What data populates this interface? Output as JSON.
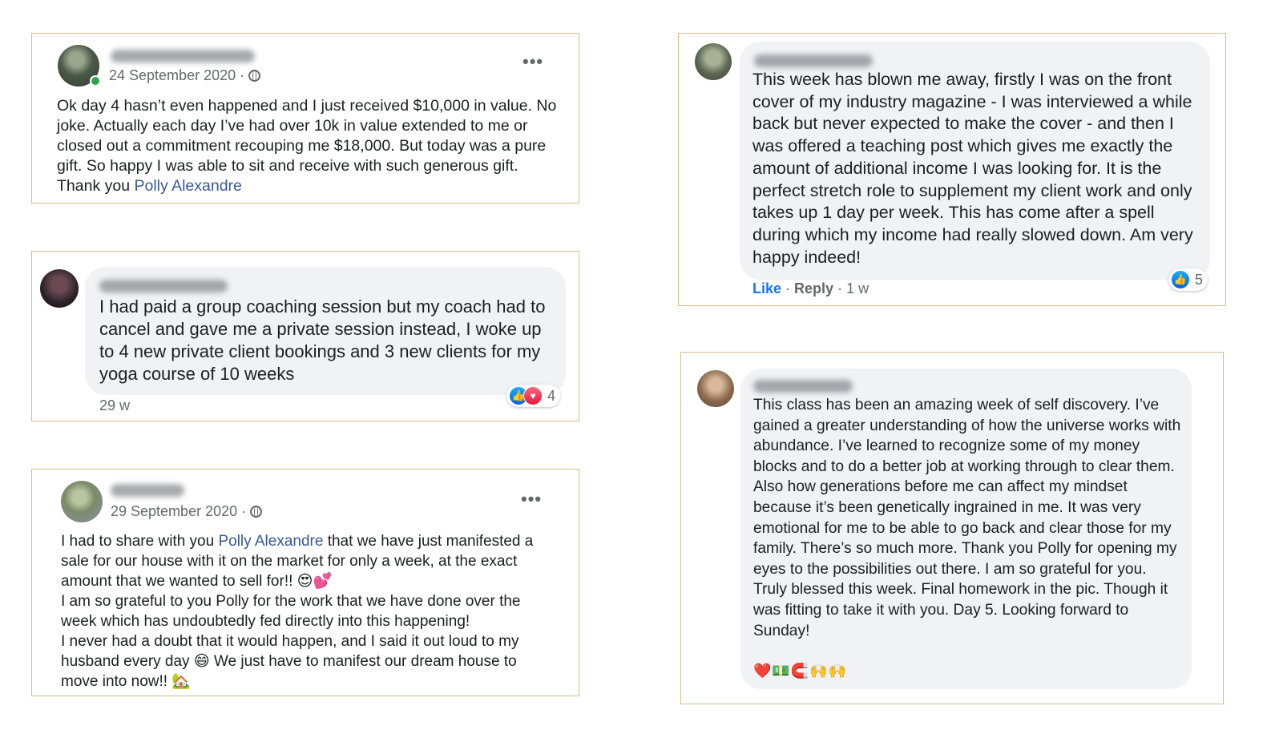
{
  "posts": {
    "p1": {
      "date": "24 September 2020 ·",
      "more_icon": "more-horizontal-icon",
      "text_a": "Ok day 4 hasn’t even happened and I just received $10,000 in value. No joke. Actually each day I’ve had over 10k in value extended to me or closed out a commitment recouping me $18,000. But today was a pure gift. So happy I was able to sit and receive with such generous gift.  Thank you ",
      "mention": "Polly Alexandre"
    },
    "p2": {
      "text": "I had paid a group coaching session but my coach had to cancel and gave me a private session instead, I woke up to 4 new private client bookings and 3 new clients for my yoga course of 10 weeks",
      "time": "29 w",
      "reactions_count": "4"
    },
    "p3": {
      "date": "29 September 2020 ·",
      "text_a": "I had to share with you ",
      "mention": "Polly Alexandre",
      "text_b": " that we have just manifested a sale for our house with it on the market for only a week, at the exact amount that we wanted to sell for!! ",
      "emoji_a": "😍💕",
      "text_c": "I am so grateful to you Polly for the work that we have done over the week which has undoubtedly fed directly into this happening!",
      "text_d": "I never had a doubt that it would happen, and I said it out loud to my husband every day ",
      "emoji_b": "😄",
      "text_e": " We just have to manifest our dream house to move into now!! ",
      "emoji_c": "🏡"
    },
    "p4": {
      "text": "This week has blown me away, firstly I was on the front cover of my industry magazine - I was interviewed a while back but never expected to make the cover - and then I was offered a teaching post which gives me exactly the amount of additional income I was looking for. It is the perfect stretch role to supplement my client work and only takes up 1 day per week. This has come after a spell during which my income had really slowed down. Am very happy indeed!",
      "like": "Like",
      "reply": "Reply",
      "time": "1 w",
      "reactions_count": "5"
    },
    "p5": {
      "text": "This class has been an amazing week of self discovery. I’ve gained a greater understanding of how the universe works with abundance. I’ve learned to recognize some of my money blocks and to do a better job at working through to clear them. Also how generations before me can affect my mindset because it’s been genetically ingrained in me. It was very emotional for me to be able to go back and clear those for my family. There’s so much more. Thank you Polly for opening my eyes to the possibilities out there. I am so grateful for you. Truly blessed this week. Final homework in the pic. Though it was fitting to take it with you. Day 5. Looking forward to Sunday!",
      "emojis": "❤️💵🧲🙌🙌"
    }
  },
  "colors": {
    "border": "#d8bc8c",
    "link": "#385898",
    "like_blue": "#1877f2",
    "bubble": "#f0f2f5"
  }
}
